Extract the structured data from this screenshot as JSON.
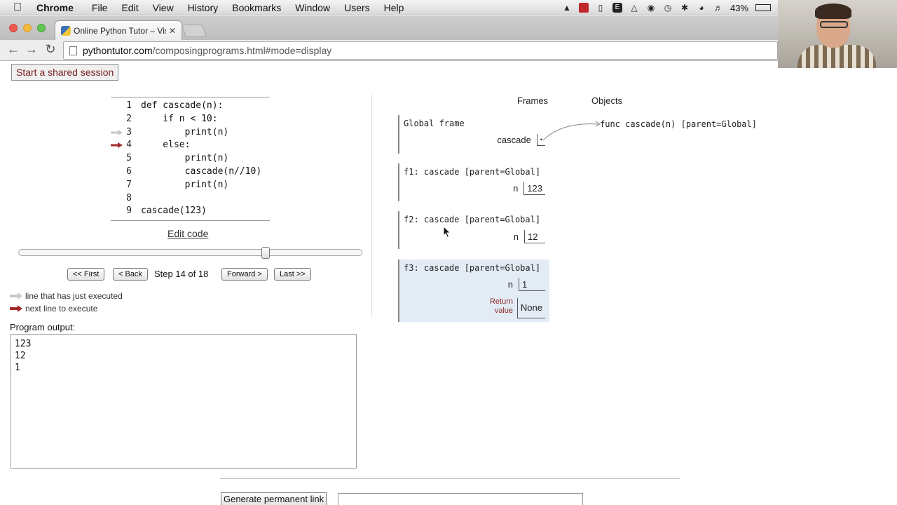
{
  "menubar": {
    "app": "Chrome",
    "items": [
      "File",
      "Edit",
      "View",
      "History",
      "Bookmarks",
      "Window",
      "Users",
      "Help"
    ],
    "battery": "43%"
  },
  "browser": {
    "tab_title": "Online Python Tutor – Visu",
    "url_host": "pythontutor.com",
    "url_path": "/composingprograms.html#mode=display"
  },
  "page": {
    "share_button": "Start a shared session",
    "code_lines": [
      {
        "num": "1",
        "text": "def cascade(n):"
      },
      {
        "num": "2",
        "text": "    if n < 10:"
      },
      {
        "num": "3",
        "text": "        print(n)"
      },
      {
        "num": "4",
        "text": "    else:"
      },
      {
        "num": "5",
        "text": "        print(n)"
      },
      {
        "num": "6",
        "text": "        cascade(n//10)"
      },
      {
        "num": "7",
        "text": "        print(n)"
      },
      {
        "num": "8",
        "text": ""
      },
      {
        "num": "9",
        "text": "cascade(123)"
      }
    ],
    "just_executed_line": 3,
    "next_line": 4,
    "edit_code": "Edit code",
    "step_progress": 0.722,
    "controls": {
      "first": "<< First",
      "back": "< Back",
      "step_text": "Step 14 of 18",
      "forward": "Forward >",
      "last": "Last >>"
    },
    "legend": {
      "executed": "line that has just executed",
      "next": "next line to execute"
    },
    "output_label": "Program output:",
    "output_lines": [
      "123",
      "12",
      "1"
    ],
    "frames_header": "Frames",
    "objects_header": "Objects",
    "frames": [
      {
        "name": "Global frame",
        "var": "cascade",
        "value": "•"
      },
      {
        "name": "f1: cascade [parent=Global]",
        "var": "n",
        "value": "123"
      },
      {
        "name": "f2: cascade [parent=Global]",
        "var": "n",
        "value": "12"
      },
      {
        "name": "f3: cascade [parent=Global]",
        "var": "n",
        "value": "1",
        "return_label_1": "Return",
        "return_label_2": "value",
        "return_value": "None"
      }
    ],
    "function_object": "func cascade(n) [parent=Global]",
    "permalink_button": "Generate permanent link",
    "colors": {
      "next_arrow": "#a32a2a",
      "executed_arrow": "#c8c8c8",
      "active_frame": "#e3ebf5"
    }
  }
}
